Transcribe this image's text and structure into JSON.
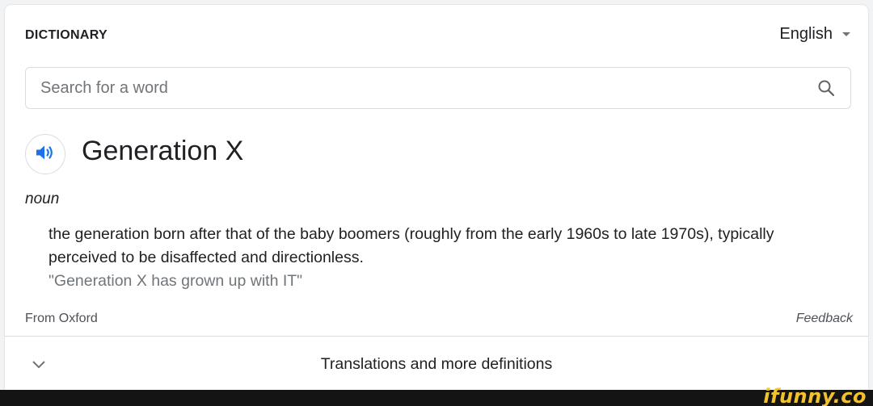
{
  "header": {
    "title": "DICTIONARY",
    "language": "English"
  },
  "search": {
    "placeholder": "Search for a word",
    "value": ""
  },
  "entry": {
    "word": "Generation X",
    "part_of_speech": "noun",
    "definition": "the generation born after that of the baby boomers (roughly from the early 1960s to late 1970s), typically perceived to be disaffected and directionless.",
    "example": "\"Generation X has grown up with IT\""
  },
  "footer": {
    "source": "From Oxford",
    "feedback": "Feedback"
  },
  "more": {
    "label": "Translations and more definitions"
  },
  "watermark": {
    "text": "ifunny.co"
  },
  "colors": {
    "accent_blue": "#1a73e8",
    "text_primary": "#202124",
    "text_secondary": "#70757a",
    "border": "#dadce0",
    "watermark": "#f2c12e"
  },
  "icons": {
    "search": "search-icon",
    "speaker": "speaker-icon",
    "chevron": "chevron-down-icon",
    "dropdown": "dropdown-arrow-icon"
  }
}
